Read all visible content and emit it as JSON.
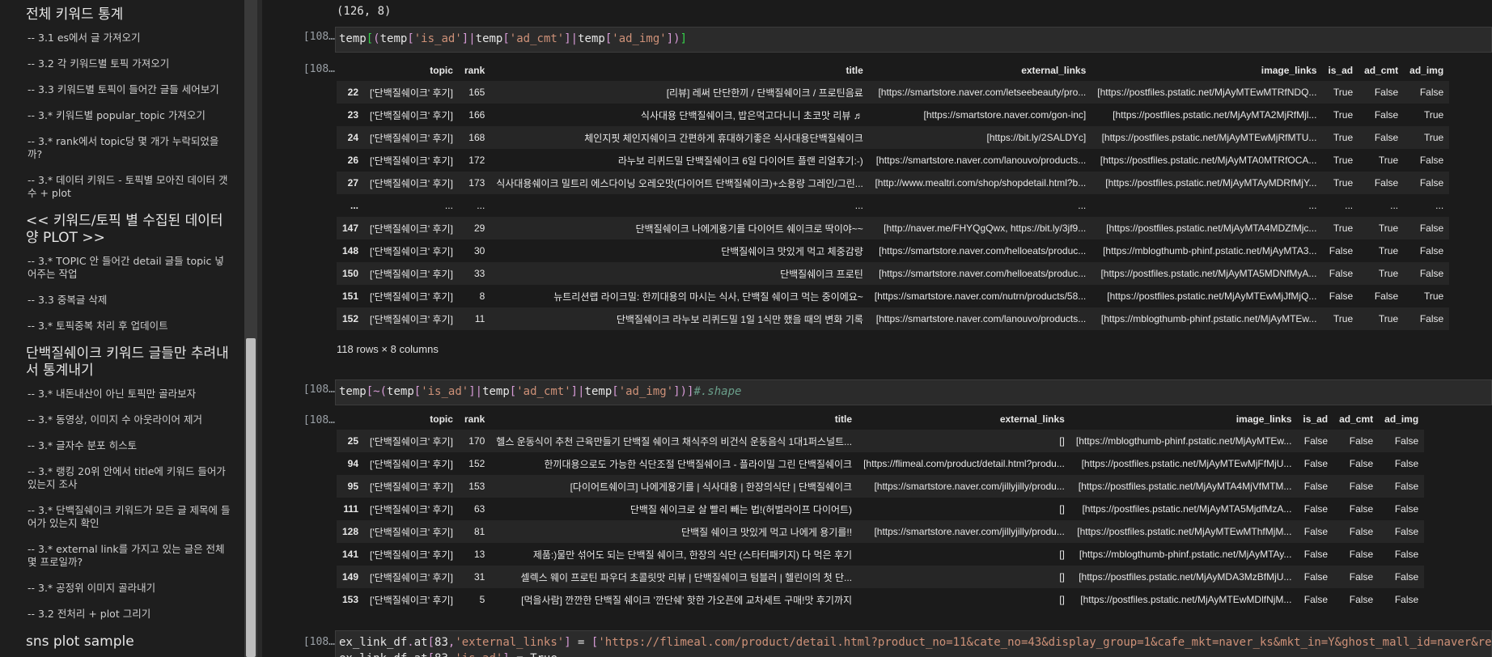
{
  "sidebar": {
    "items": [
      {
        "type": "h",
        "text": "전체 키워드 통계"
      },
      {
        "type": "i",
        "text": "-- 3.1 es에서 글 가져오기"
      },
      {
        "type": "i",
        "text": "-- 3.2 각 키워드별 토픽 가져오기"
      },
      {
        "type": "i",
        "text": "-- 3.3 키워드별 토픽이 들어간 글들 세어보기"
      },
      {
        "type": "i",
        "text": "-- 3.* 키워드별 popular_topic 가져오기"
      },
      {
        "type": "i",
        "text": "-- 3.* rank에서 topic당 몇 개가 누락되었을까?"
      },
      {
        "type": "i",
        "text": "-- 3.* 데이터 키워드 - 토픽별 모아진 데이터 갯수 + plot"
      },
      {
        "type": "h",
        "text": "<< 키워드/토픽 별 수집된 데이터양 PLOT >>"
      },
      {
        "type": "i",
        "text": "-- 3.* TOPIC 안 들어간 detail 글들 topic 넣어주는 작업"
      },
      {
        "type": "i",
        "text": "-- 3.3 중복글 삭제"
      },
      {
        "type": "i",
        "text": "-- 3.* 토픽중복 처리 후 업데이트"
      },
      {
        "type": "h",
        "text": "단백질쉐이크 키워드 글들만 추려내서 통계내기"
      },
      {
        "type": "i",
        "text": "-- 3.* 내돈내산이 아닌 토픽만 골라보자"
      },
      {
        "type": "i",
        "text": "-- 3.* 동영상, 이미지 수 아웃라이어 제거"
      },
      {
        "type": "i",
        "text": "-- 3.* 글자수 분포 히스토"
      },
      {
        "type": "i",
        "text": "-- 3.* 랭킹 20위 안에서 title에 키워드 들어가 있는지 조사"
      },
      {
        "type": "i",
        "text": "-- 3.* 단백질쉐이크 키워드가 모든 글 제목에 들어가 있는지 확인"
      },
      {
        "type": "i",
        "text": "-- 3.* external link를 가지고 있는 글은 전체 몇 프로일까?"
      },
      {
        "type": "i",
        "text": "-- 3.* 공정위 이미지 골라내기"
      },
      {
        "type": "i",
        "text": "-- 3.2 전처리 + plot 그리기"
      },
      {
        "type": "h",
        "text": "sns plot sample"
      }
    ]
  },
  "notebook": {
    "shape_output": "(126, 8)",
    "cell1": {
      "prompt": "[108…",
      "code_tokens": [
        [
          "tk-var",
          "temp"
        ],
        [
          "tk-grn",
          "["
        ],
        [
          "tk-pun",
          "("
        ],
        [
          "tk-var",
          "temp"
        ],
        [
          "tk-pun",
          "["
        ],
        [
          "tk-str",
          "'is_ad'"
        ],
        [
          "tk-pun",
          "]"
        ],
        [
          "tk-pun",
          "|"
        ],
        [
          "tk-var",
          "temp"
        ],
        [
          "tk-pun",
          "["
        ],
        [
          "tk-str",
          "'ad_cmt'"
        ],
        [
          "tk-pun",
          "]"
        ],
        [
          "tk-pun",
          "|"
        ],
        [
          "tk-var",
          "temp"
        ],
        [
          "tk-pun",
          "["
        ],
        [
          "tk-str",
          "'ad_img'"
        ],
        [
          "tk-pun",
          "])"
        ],
        [
          "tk-grn",
          "]"
        ]
      ],
      "out_prompt": "[108…",
      "columns": [
        "",
        "topic",
        "rank",
        "title",
        "external_links",
        "image_links",
        "is_ad",
        "ad_cmt",
        "ad_img"
      ],
      "rows": [
        [
          "22",
          "['단백질쉐이크' 후기]",
          "165",
          "[리뷰] 레써 단단한끼 / 단백질쉐이크 / 프로틴음료",
          "[https://smartstore.naver.com/letseebeauty/pro...",
          "[https://postfiles.pstatic.net/MjAyMTEwMTRfNDQ...",
          "True",
          "False",
          "False"
        ],
        [
          "23",
          "['단백질쉐이크' 후기]",
          "166",
          "식사대용 단백질쉐이크, 밥은먹고다니니 초코맛 리뷰 ♬",
          "[https://smartstore.naver.com/gon-inc]",
          "[https://postfiles.pstatic.net/MjAyMTA2MjRfMjl...",
          "True",
          "False",
          "True"
        ],
        [
          "24",
          "['단백질쉐이크' 후기]",
          "168",
          "체인지핏 체인지쉐이크 간편하게 휴대하기좋은 식사대용단백질쉐이크",
          "[https://bit.ly/2SALDYc]",
          "[https://postfiles.pstatic.net/MjAyMTEwMjRfMTU...",
          "True",
          "False",
          "True"
        ],
        [
          "26",
          "['단백질쉐이크' 후기]",
          "172",
          "라누보 리퀴드밀 단백질쉐이크 6일 다이어트 플랜 리얼후기:-)",
          "[https://smartstore.naver.com/lanouvo/products...",
          "[https://postfiles.pstatic.net/MjAyMTA0MTRfOCA...",
          "True",
          "True",
          "False"
        ],
        [
          "27",
          "['단백질쉐이크' 후기]",
          "173",
          "식사대용쉐이크 밀트리 에스다이닝 오레오맛(다이어트 단백질쉐이크)+소용량 그레인/그린...",
          "[http://www.mealtri.com/shop/shopdetail.html?b...",
          "[https://postfiles.pstatic.net/MjAyMTAyMDRfMjY...",
          "True",
          "False",
          "False"
        ],
        [
          "...",
          "...",
          "...",
          "...",
          "...",
          "...",
          "...",
          "...",
          "..."
        ],
        [
          "147",
          "['단백질쉐이크' 후기]",
          "29",
          "단백질쉐이크 나에게용기를 다이어트 쉐이크로 딱이야~~",
          "[http://naver.me/FHYQgQwx, https://bit.ly/3jf9...",
          "[https://postfiles.pstatic.net/MjAyMTA4MDZfMjc...",
          "True",
          "True",
          "False"
        ],
        [
          "148",
          "['단백질쉐이크' 후기]",
          "30",
          "단백질쉐이크 맛있게 먹고 체중감량",
          "[https://smartstore.naver.com/helloeats/produc...",
          "[https://mblogthumb-phinf.pstatic.net/MjAyMTA3...",
          "False",
          "True",
          "False"
        ],
        [
          "150",
          "['단백질쉐이크' 후기]",
          "33",
          "단백질쉐이크 프로틴",
          "[https://smartstore.naver.com/helloeats/produc...",
          "[https://postfiles.pstatic.net/MjAyMTA5MDNfMyA...",
          "False",
          "True",
          "False"
        ],
        [
          "151",
          "['단백질쉐이크' 후기]",
          "8",
          "뉴트리션랩 라이크밀: 한끼대용의 마시는 식사, 단백질 쉐이크 먹는 중이에요~",
          "[https://smartstore.naver.com/nutrn/products/58...",
          "[https://postfiles.pstatic.net/MjAyMTEwMjJfMjQ...",
          "False",
          "False",
          "True"
        ],
        [
          "152",
          "['단백질쉐이크' 후기]",
          "11",
          "단백질쉐이크 라누보 리퀴드밀 1일 1식만 했을 때의 변화 기록",
          "[https://smartstore.naver.com/lanouvo/products...",
          "[https://mblogthumb-phinf.pstatic.net/MjAyMTEw...",
          "True",
          "True",
          "False"
        ]
      ],
      "rows_note": "118 rows × 8 columns"
    },
    "cell2": {
      "prompt": "[108…",
      "code_tokens": [
        [
          "tk-var",
          "temp"
        ],
        [
          "tk-pun",
          "["
        ],
        [
          "tk-pun",
          "~"
        ],
        [
          "tk-pun",
          "("
        ],
        [
          "tk-var",
          "temp"
        ],
        [
          "tk-pun",
          "["
        ],
        [
          "tk-str",
          "'is_ad'"
        ],
        [
          "tk-pun",
          "]"
        ],
        [
          "tk-pun",
          "|"
        ],
        [
          "tk-var",
          "temp"
        ],
        [
          "tk-pun",
          "["
        ],
        [
          "tk-str",
          "'ad_cmt'"
        ],
        [
          "tk-pun",
          "]"
        ],
        [
          "tk-pun",
          "|"
        ],
        [
          "tk-var",
          "temp"
        ],
        [
          "tk-pun",
          "["
        ],
        [
          "tk-str",
          "'ad_img'"
        ],
        [
          "tk-pun",
          "])"
        ],
        [
          "tk-pun",
          "]"
        ],
        [
          "tk-com",
          "#.shape"
        ]
      ],
      "out_prompt": "[108…",
      "columns": [
        "",
        "topic",
        "rank",
        "title",
        "external_links",
        "image_links",
        "is_ad",
        "ad_cmt",
        "ad_img"
      ],
      "rows": [
        [
          "25",
          "['단백질쉐이크' 후기]",
          "170",
          "헬스 운동식이 추천 근육만들기 단백질 쉐이크 채식주의 비건식 운동음식 1대1퍼스널트...",
          "[]",
          "[https://mblogthumb-phinf.pstatic.net/MjAyMTEw...",
          "False",
          "False",
          "False"
        ],
        [
          "94",
          "['단백질쉐이크' 후기]",
          "152",
          "한끼대용으로도 가능한 식단조절 단백질쉐이크 - 플라이밀 그린 단백질쉐이크",
          "[https://flimeal.com/product/detail.html?produ...",
          "[https://postfiles.pstatic.net/MjAyMTEwMjFfMjU...",
          "False",
          "False",
          "False"
        ],
        [
          "95",
          "['단백질쉐이크' 후기]",
          "153",
          "[다이어트쉐이크] 나에게용기를 | 식사대용 | 한장의식단 | 단백질쉐이크",
          "[https://smartstore.naver.com/jillyjilly/produ...",
          "[https://postfiles.pstatic.net/MjAyMTA4MjVfMTM...",
          "False",
          "False",
          "False"
        ],
        [
          "111",
          "['단백질쉐이크' 후기]",
          "63",
          "단백질 쉐이크로 살 빨리 빼는 법!(허벌라이프 다이어트)",
          "[]",
          "[https://postfiles.pstatic.net/MjAyMTA5MjdfMzA...",
          "False",
          "False",
          "False"
        ],
        [
          "128",
          "['단백질쉐이크' 후기]",
          "81",
          "단백질 쉐이크 맛있게 먹고 나에게 용기를!!",
          "[https://smartstore.naver.com/jillyjilly/produ...",
          "[https://postfiles.pstatic.net/MjAyMTEwMThfMjM...",
          "False",
          "False",
          "False"
        ],
        [
          "141",
          "['단백질쉐이크' 후기]",
          "13",
          "제품:)물만 섞어도 되는 단백질 쉐이크, 한장의 식단 (스타터패키지) 다 먹은 후기",
          "[]",
          "[https://mblogthumb-phinf.pstatic.net/MjAyMTAy...",
          "False",
          "False",
          "False"
        ],
        [
          "149",
          "['단백질쉐이크' 후기]",
          "31",
          "셀렉스 웨이 프로틴 파우더 초콜릿맛 리뷰 | 단백질쉐이크 텀블러 | 헬린이의 첫 단...",
          "[]",
          "[https://postfiles.pstatic.net/MjAyMDA3MzBfMjU...",
          "False",
          "False",
          "False"
        ],
        [
          "153",
          "['단백질쉐이크' 후기]",
          "5",
          "[먹을사람] 깐깐한 단백질 쉐이크 '깐단쉐' 핫한 가오픈에 교차세트 구매!맛 후기까지",
          "[]",
          "[https://postfiles.pstatic.net/MjAyMTEwMDlfNjM...",
          "False",
          "False",
          "False"
        ]
      ]
    },
    "cell3": {
      "prompt": "[108…",
      "line1_tokens": [
        [
          "tk-var",
          "ex_link_df"
        ],
        [
          "tk-pun",
          "."
        ],
        [
          "tk-var",
          "at"
        ],
        [
          "tk-pun",
          "["
        ],
        [
          "tk-var",
          "83"
        ],
        [
          "tk-pun",
          ","
        ],
        [
          "tk-str",
          "'external_links'"
        ],
        [
          "tk-pun",
          "]"
        ],
        [
          "tk-var",
          " = "
        ],
        [
          "tk-pun",
          "["
        ],
        [
          "tk-str",
          "'https://flimeal.com/product/detail.html?product_no=11&cate_no=43&display_group=1&cafe_mkt=naver_ks&mkt_in=Y&ghost_mall_id=naver&ref=naver"
        ]
      ],
      "line2_tokens": [
        [
          "tk-var",
          "ex_link_df"
        ],
        [
          "tk-pun",
          "."
        ],
        [
          "tk-var",
          "at"
        ],
        [
          "tk-pun",
          "["
        ],
        [
          "tk-var",
          "83"
        ],
        [
          "tk-pun",
          ","
        ],
        [
          "tk-str",
          "'is_ad'"
        ],
        [
          "tk-pun",
          "]"
        ],
        [
          "tk-var",
          " = True"
        ]
      ]
    }
  }
}
